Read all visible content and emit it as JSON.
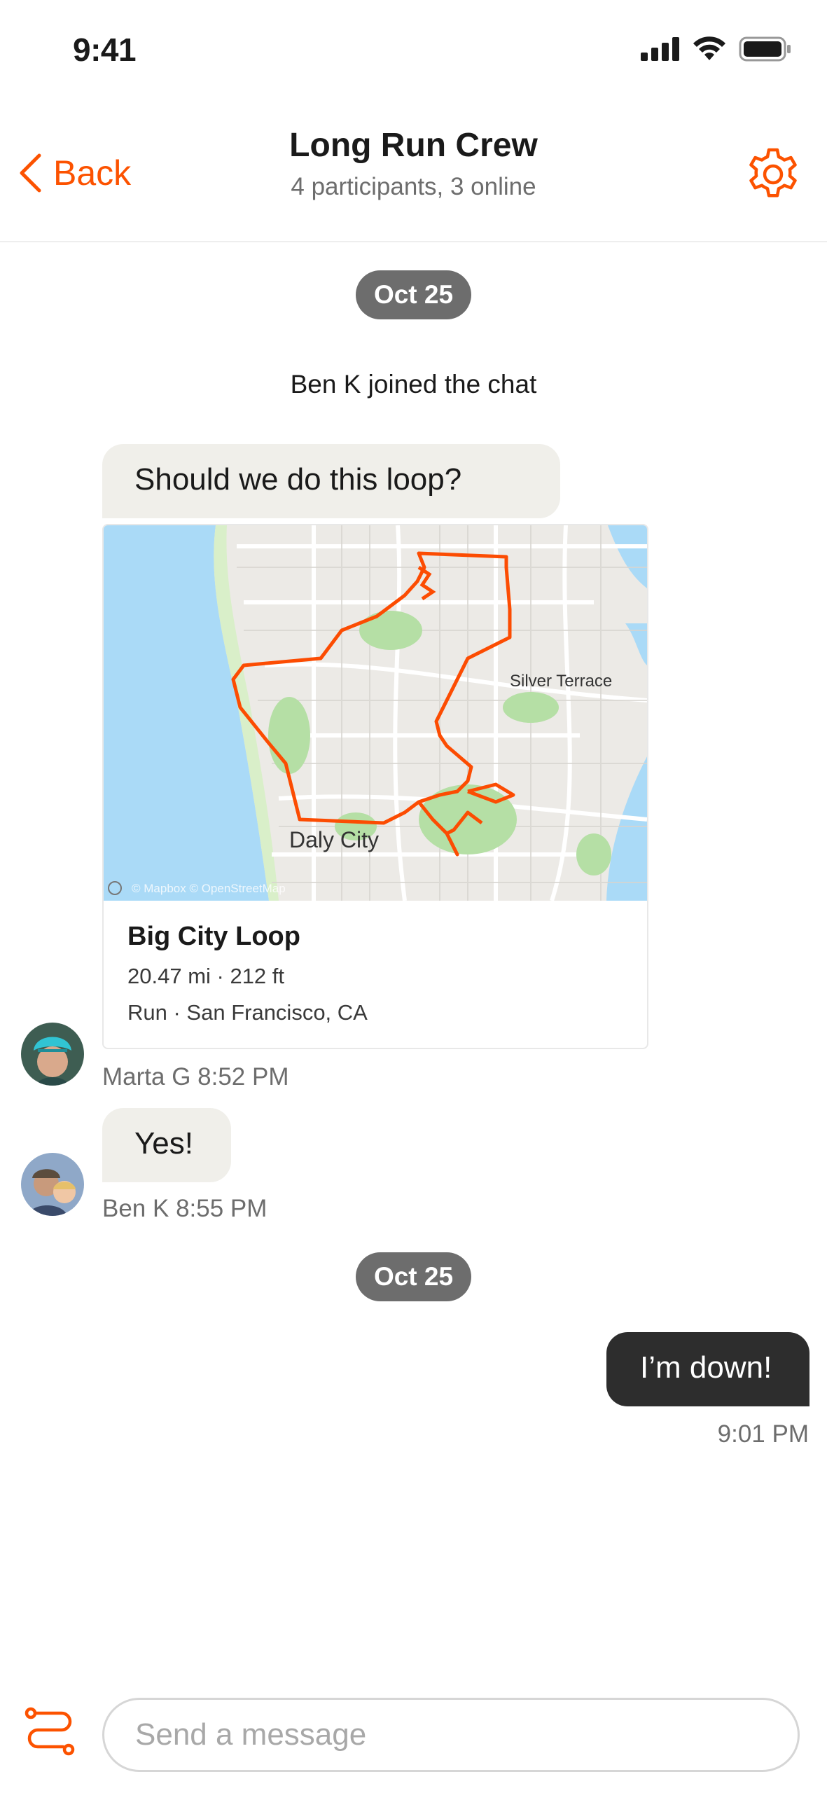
{
  "status_bar": {
    "time": "9:41"
  },
  "header": {
    "back_label": "Back",
    "title": "Long Run Crew",
    "subtitle": "4 participants, 3 online"
  },
  "messages": {
    "date_chip_1": "Oct 25",
    "system": "Ben K joined the chat",
    "bubble_1": "Should we do this loop?",
    "route_card": {
      "title": "Big City Loop",
      "stats": "20.47 mi · 212 ft",
      "location": "Run · San Francisco, CA",
      "map_labels": {
        "area_1": "Silver Terrace",
        "area_2": "Daly City",
        "attribution": "© Mapbox © OpenStreetMap"
      }
    },
    "marta_meta": "Marta G  8:52 PM",
    "bubble_yes": "Yes!",
    "ben_meta": "Ben K  8:55 PM",
    "date_chip_2": "Oct 25",
    "bubble_mine": "I’m down!",
    "mine_time": "9:01 PM"
  },
  "composer": {
    "placeholder": "Send a message"
  },
  "colors": {
    "accent": "#fc5200",
    "route": "#fc4c02",
    "dark_bubble": "#2d2d2d",
    "gray_bubble": "#f0efea"
  },
  "icons": [
    "back-chevron-icon",
    "gear-icon",
    "route-icon",
    "signal-icon",
    "wifi-icon",
    "battery-icon"
  ]
}
